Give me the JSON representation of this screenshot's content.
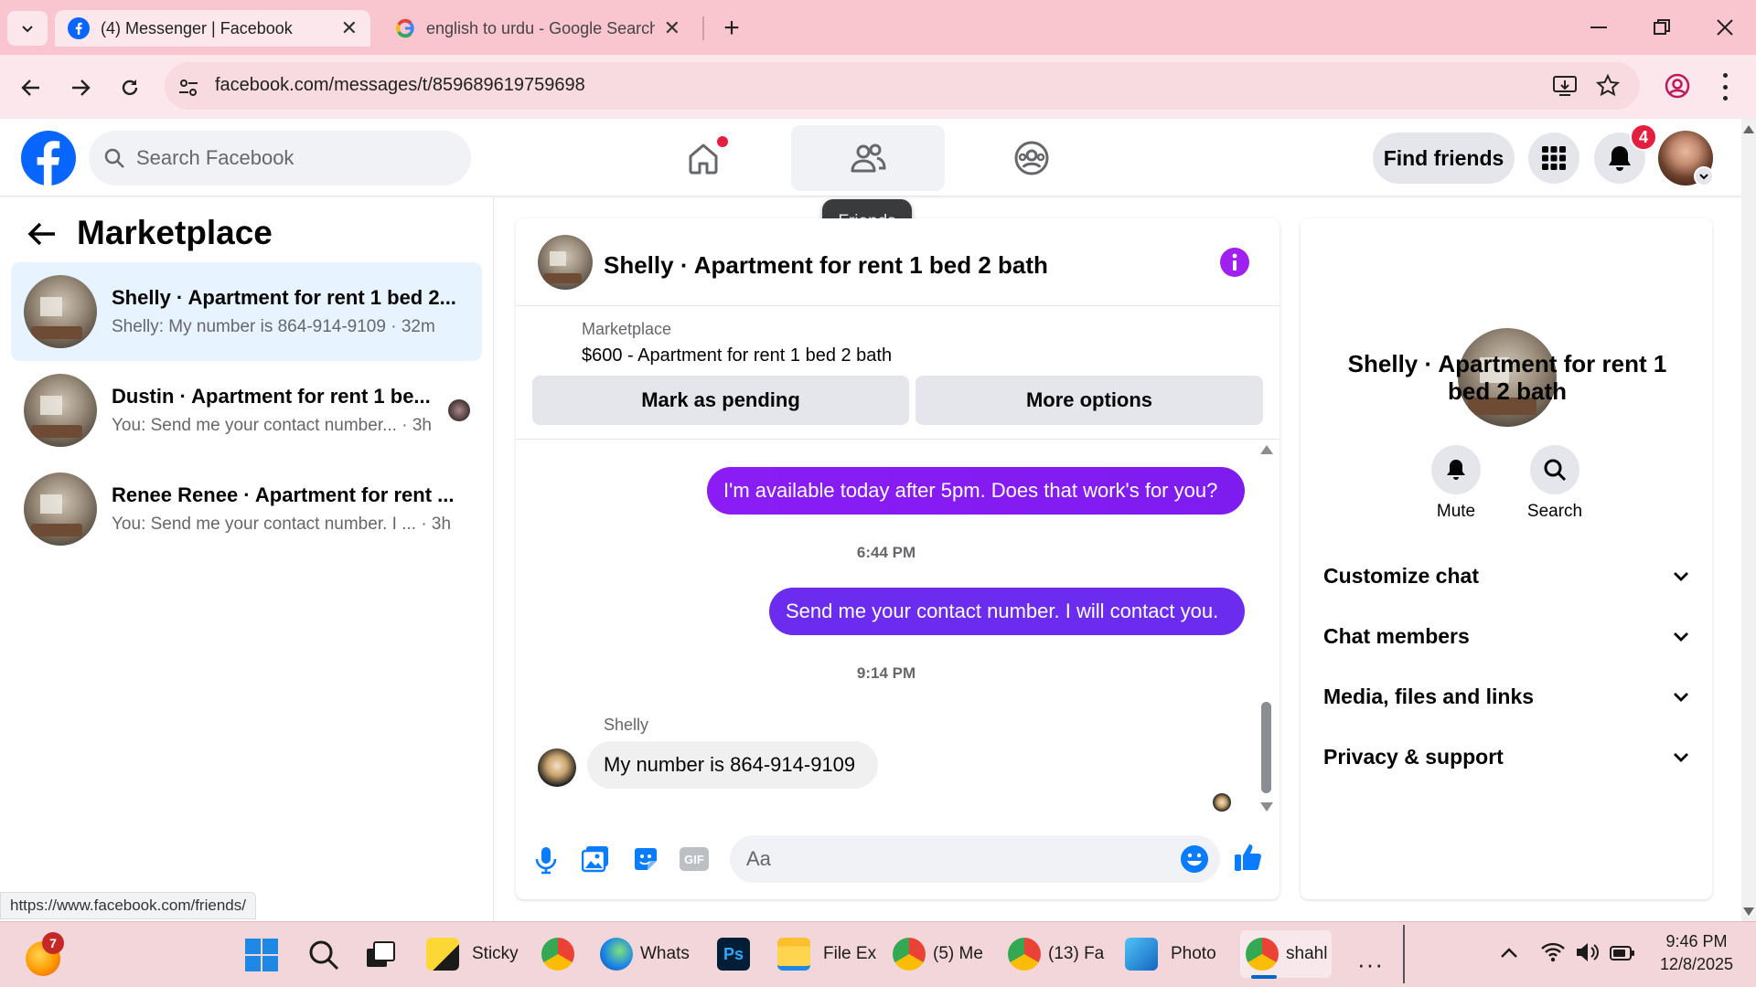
{
  "browser": {
    "tabs": [
      {
        "title": "(4) Messenger | Facebook",
        "icon": "facebook-icon"
      },
      {
        "title": "english to urdu - Google Search",
        "icon": "google-icon"
      }
    ],
    "url": "facebook.com/messages/t/859689619759698",
    "status_url": "https://www.facebook.com/friends/"
  },
  "header": {
    "search_placeholder": "Search Facebook",
    "find_friends": "Find friends",
    "notification_count": "4",
    "tooltip": "Friends"
  },
  "left": {
    "title": "Marketplace",
    "conversations": [
      {
        "name": "Shelly · Apartment for rent 1 bed 2...",
        "preview": "Shelly: My number is 864-914-9109 · 32m",
        "selected": true
      },
      {
        "name": "Dustin · Apartment for rent 1 be...",
        "preview": "You: Send me your contact number... · 3h",
        "selected": false
      },
      {
        "name": "Renee Renee · Apartment for rent ...",
        "preview": "You: Send me your contact number. I ... · 3h",
        "selected": false
      }
    ]
  },
  "chat": {
    "title": "Shelly · Apartment for rent 1 bed 2 bath",
    "listing_label": "Marketplace",
    "listing_title": "$600 - Apartment for rent 1 bed 2 bath",
    "mark_pending": "Mark as pending",
    "more_options": "More options",
    "messages": {
      "m1": "I'm available today after 5pm. Does that work's for you?",
      "t1": "6:44 PM",
      "m2": "Send me your contact number. I will contact you.",
      "t2": "9:14 PM",
      "sender": "Shelly",
      "m3": "My number is 864-914-9109"
    },
    "composer_placeholder": "Aa"
  },
  "right": {
    "name": "Shelly · Apartment for rent 1 bed 2 bath",
    "mute": "Mute",
    "search": "Search",
    "sections": [
      "Customize chat",
      "Chat members",
      "Media, files and links",
      "Privacy & support"
    ]
  },
  "taskbar": {
    "items": [
      "Sticky",
      "Whats",
      "File Ex",
      "(5) Me",
      "(13) Fa",
      "Photo",
      "shahl"
    ],
    "badge": "7",
    "time": "9:46 PM",
    "date": "12/8/2025"
  },
  "colors": {
    "fb_blue": "#0866ff",
    "accent_purple": "#8b1cf5",
    "notif_red": "#e41e3f"
  }
}
